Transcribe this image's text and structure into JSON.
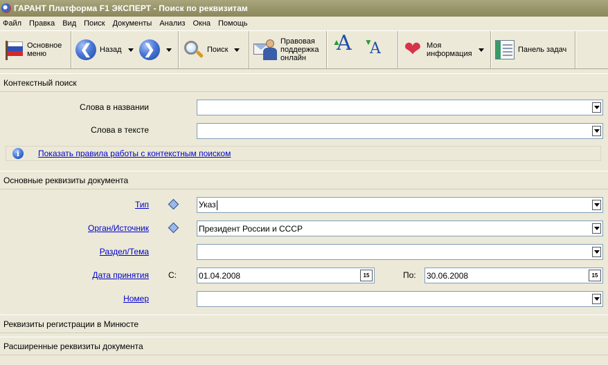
{
  "window": {
    "title": "ГАРАНТ Платформа F1 ЭКСПЕРТ - Поиск по реквизитам"
  },
  "menu": [
    "Файл",
    "Правка",
    "Вид",
    "Поиск",
    "Документы",
    "Анализ",
    "Окна",
    "Помощь"
  ],
  "toolbar": {
    "main_menu_line1": "Основное",
    "main_menu_line2": "меню",
    "back": "Назад",
    "search": "Поиск",
    "support_line1": "Правовая",
    "support_line2": "поддержка",
    "support_line3": "онлайн",
    "font_letter": "A",
    "myinfo_line1": "Моя",
    "myinfo_line2": "информация",
    "taskbar": "Панель задач"
  },
  "sections": {
    "context": "Контекстный поиск",
    "basic": "Основные реквизиты документа",
    "minjust": "Реквизиты регистрации в Минюсте",
    "extended": "Расширенные реквизиты документа"
  },
  "context_search": {
    "title_words_label": "Слова в названии",
    "title_words_value": "",
    "text_words_label": "Слова в тексте",
    "text_words_value": "",
    "rules_link": "Показать правила работы с контекстным поиском"
  },
  "basic": {
    "type_label": "Тип",
    "type_value": "Указ",
    "organ_label": "Орган/Источник",
    "organ_value": "Президент России и СССР",
    "topic_label": "Раздел/Тема",
    "topic_value": "",
    "date_label": "Дата принятия",
    "from_label": "С:",
    "from_value": "01.04.2008",
    "to_label": "По:",
    "to_value": "30.06.2008",
    "calendar_glyph": "15",
    "number_label": "Номер",
    "number_value": ""
  }
}
